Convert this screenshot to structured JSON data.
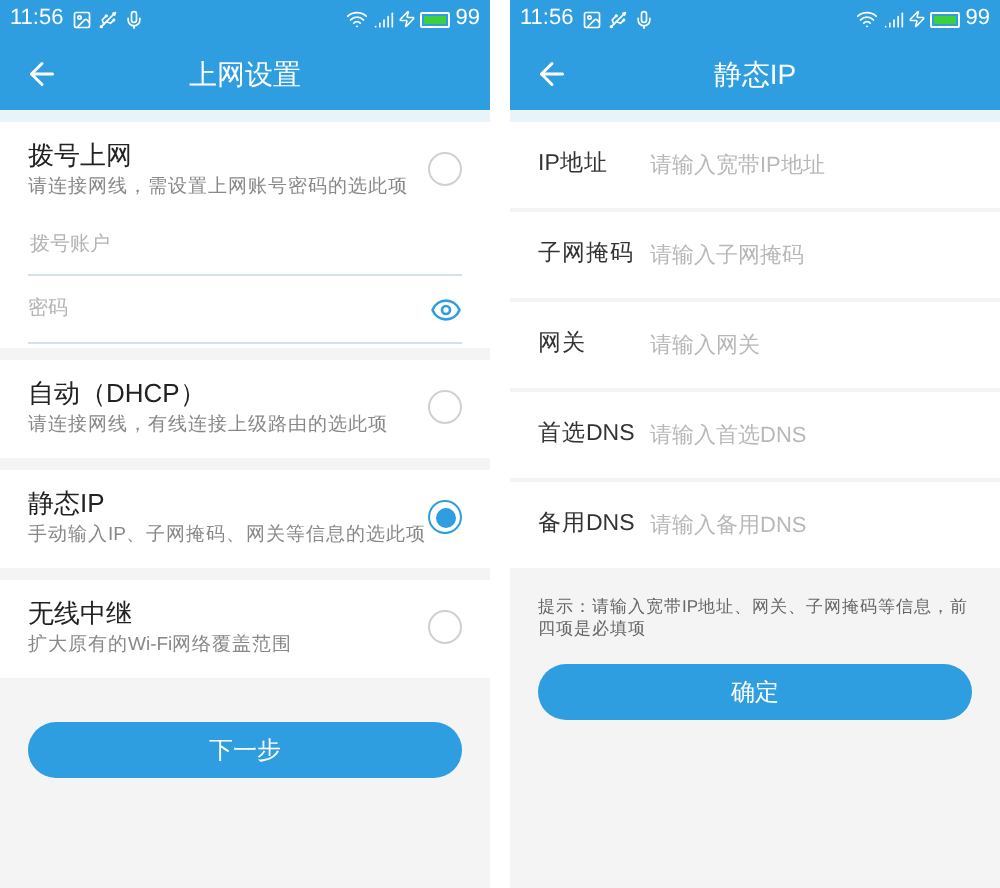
{
  "screens": [
    {
      "status_bar": {
        "time": "11:56",
        "battery": "99"
      },
      "title": "上网设置",
      "options": [
        {
          "title": "拨号上网",
          "subtitle": "请连接网线，需设置上网账号密码的选此项",
          "selected": false,
          "fields": [
            {
              "kind": "text",
              "placeholder": "拨号账户"
            },
            {
              "kind": "password",
              "placeholder": "密码"
            }
          ]
        },
        {
          "title": "自动（DHCP）",
          "subtitle": "请连接网线，有线连接上级路由的选此项",
          "selected": false
        },
        {
          "title": "静态IP",
          "subtitle": "手动输入IP、子网掩码、网关等信息的选此项",
          "selected": true
        },
        {
          "title": "无线中继",
          "subtitle": "扩大原有的Wi-Fi网络覆盖范围",
          "selected": false
        }
      ],
      "button": "下一步"
    },
    {
      "status_bar": {
        "time": "11:56",
        "battery": "99"
      },
      "title": "静态IP",
      "form": [
        {
          "label": "IP地址",
          "placeholder": "请输入宽带IP地址"
        },
        {
          "label": "子网掩码",
          "placeholder": "请输入子网掩码"
        },
        {
          "label": "网关",
          "placeholder": "请输入网关"
        },
        {
          "label": "首选DNS",
          "placeholder": "请输入首选DNS"
        },
        {
          "label": "备用DNS",
          "placeholder": "请输入备用DNS"
        }
      ],
      "hint": "提示：请输入宽带IP地址、网关、子网掩码等信息，前四项是必填项",
      "button": "确定"
    }
  ]
}
